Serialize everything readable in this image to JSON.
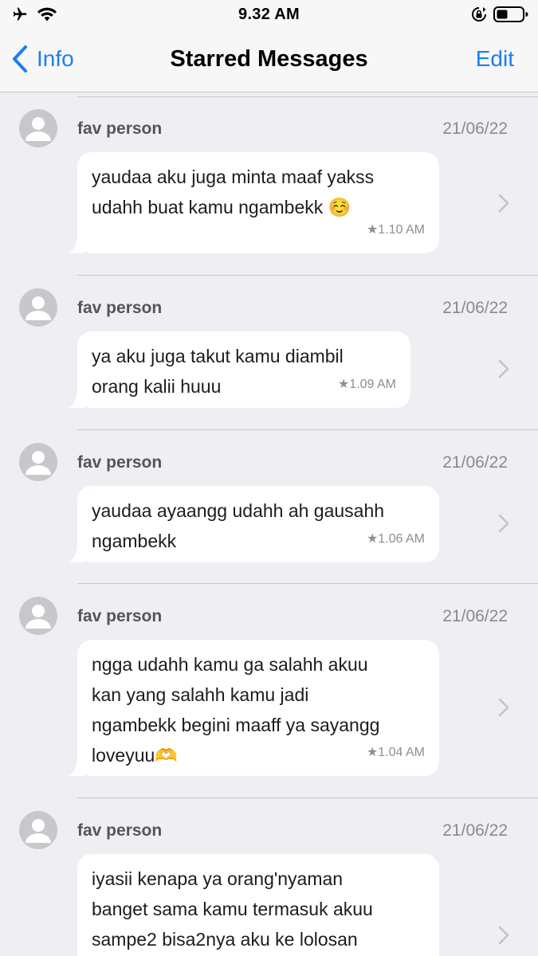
{
  "status_bar": {
    "time": "9.32 AM",
    "icons": [
      "airplane-icon",
      "wifi-icon",
      "orientation-lock-icon",
      "battery-icon"
    ]
  },
  "nav": {
    "back_label": "Info",
    "title": "Starred Messages",
    "edit_label": "Edit"
  },
  "accent_color": "#1a7ef2",
  "messages": [
    {
      "sender": "fav person",
      "date": "21/06/22",
      "text": "yaudaa aku juga minta maaf yakss\nudahh buat kamu ngambekk ☺️",
      "time": "★1.10 AM"
    },
    {
      "sender": "fav person",
      "date": "21/06/22",
      "text": "ya aku juga takut kamu diambil\norang kalii huuu",
      "time": "★1.09 AM"
    },
    {
      "sender": "fav person",
      "date": "21/06/22",
      "text": "yaudaa ayaangg udahh ah gausahh\nngambekk",
      "time": "★1.06 AM"
    },
    {
      "sender": "fav person",
      "date": "21/06/22",
      "text": "ngga udahh kamu ga salahh akuu\nkan yang salahh kamu jadi\nngambekk begini maaff ya sayangg\nloveyuu🫶",
      "time": "★1.04 AM"
    },
    {
      "sender": "fav person",
      "date": "21/06/22",
      "text": "iyasii kenapa ya orang'nyaman\nbanget sama kamu termasuk akuu\nsampe2 bisa2nya aku ke lolosan",
      "time": ""
    }
  ]
}
